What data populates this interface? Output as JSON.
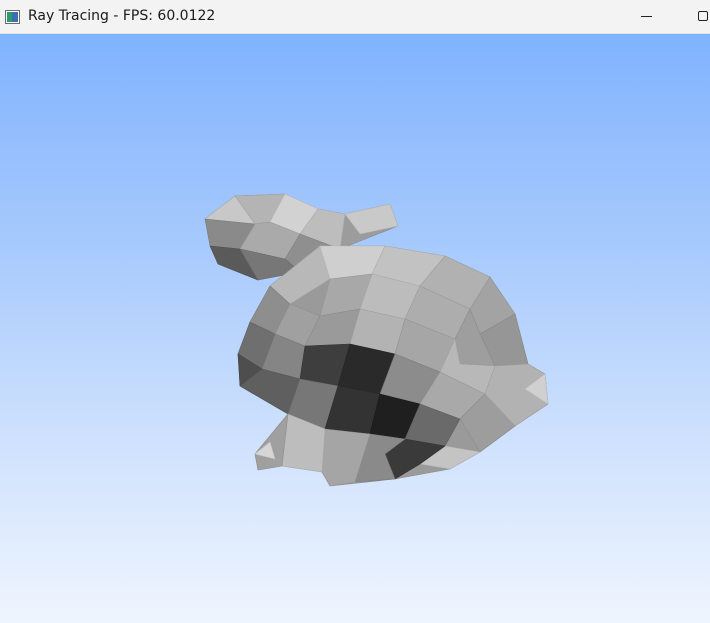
{
  "window": {
    "title": "Ray Tracing - FPS: 60.0122",
    "icon": "app-window-icon",
    "controls": [
      "minimize-icon",
      "maximize-icon"
    ]
  },
  "scene": {
    "object": "stanford-bunny-lowpoly",
    "background_top_color": "#80b3fe",
    "background_bottom_color": "#eff5fe",
    "mesh_base_color": "#9a9a9a"
  }
}
